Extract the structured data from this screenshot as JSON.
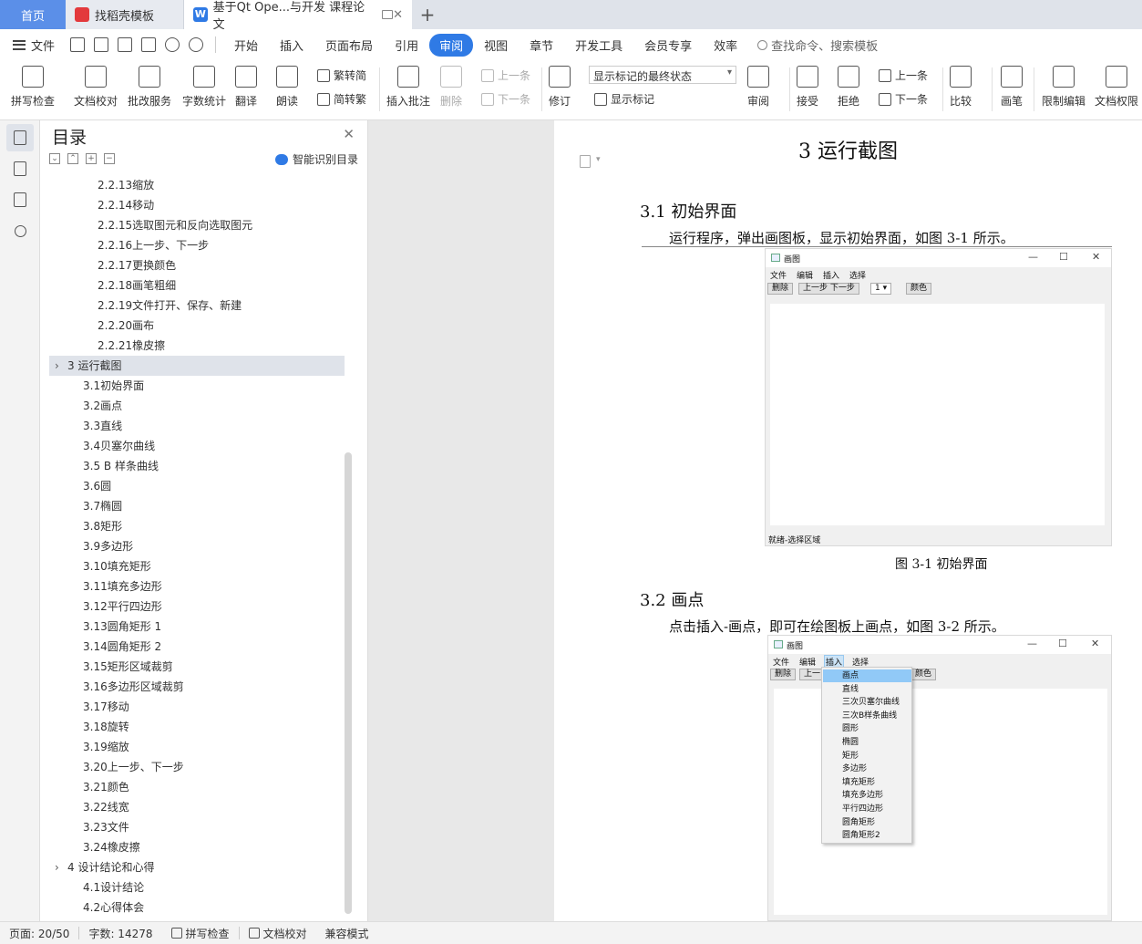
{
  "tabs": {
    "home": "首页",
    "template": "找稻壳模板",
    "document": "基于Qt Ope...与开发 课程论文"
  },
  "menu": {
    "file": "文件",
    "items": [
      "开始",
      "插入",
      "页面布局",
      "引用",
      "审阅",
      "视图",
      "章节",
      "开发工具",
      "会员专享",
      "效率"
    ],
    "active": "审阅",
    "search": "查找命令、搜索模板"
  },
  "ribbon": {
    "spellcheck": "拼写检查",
    "doc_proof": "文档校对",
    "revision_service": "批改服务",
    "word_count": "字数统计",
    "translate": "翻译",
    "read_aloud": "朗读",
    "to_traditional": "繁转简",
    "to_simplified": "简转繁",
    "insert_comment": "插入批注",
    "delete": "删除",
    "prev_comment": "上一条",
    "next_comment": "下一条",
    "track": "修订",
    "markup_dropdown": "显示标记的最终状态",
    "show_markup": "显示标记",
    "review": "审阅",
    "accept": "接受",
    "reject": "拒绝",
    "prev_change": "上一条",
    "next_change": "下一条",
    "compare": "比较",
    "pen": "画笔",
    "restrict_edit": "限制编辑",
    "doc_permission": "文档权限"
  },
  "toc": {
    "title": "目录",
    "smart": "智能识别目录",
    "items": [
      "2.2.13缩放",
      "2.2.14移动",
      "2.2.15选取图元和反向选取图元",
      "2.2.16上一步、下一步",
      "2.2.17更换颜色",
      "2.2.18画笔粗细",
      "2.2.19文件打开、保存、新建",
      "2.2.20画布",
      "2.2.21橡皮擦",
      "3 运行截图",
      "3.1初始界面",
      "3.2画点",
      "3.3直线",
      "3.4贝塞尔曲线",
      "3.5  B 样条曲线",
      "3.6圆",
      "3.7椭圆",
      "3.8矩形",
      "3.9多边形",
      "3.10填充矩形",
      "3.11填充多边形",
      "3.12平行四边形",
      "3.13圆角矩形 1",
      "3.14圆角矩形 2",
      "3.15矩形区域裁剪",
      "3.16多边形区域裁剪",
      "3.17移动",
      "3.18旋转",
      "3.19缩放",
      "3.20上一步、下一步",
      "3.21颜色",
      "3.22线宽",
      "3.23文件",
      "3.24橡皮擦",
      "4 设计结论和心得",
      "4.1设计结论",
      "4.2心得体会"
    ]
  },
  "doc": {
    "chapter_title": "3 运行截图",
    "s31_heading": "3.1  初始界面",
    "s31_text": "运行程序，弹出画图板，显示初始界面，如图 3-1 所示。",
    "fig1_caption": "图 3-1  初始界面",
    "s32_heading": "3.2  画点",
    "s32_text": "点击插入-画点，即可在绘图板上画点，如图 3-2 所示。",
    "app": {
      "title": "画图",
      "menu": [
        "文件",
        "编辑",
        "插入",
        "选择"
      ],
      "btn_delete": "删除",
      "btn_undo_redo": "上一步 下一步",
      "btn_undo_clip": "上一",
      "width_value": "1",
      "btn_color": "颜色",
      "status": "就绪-选择区域",
      "insert_menu": [
        "画点",
        "直线",
        "三次贝塞尔曲线",
        "三次B样条曲线",
        "圆形",
        "椭圆",
        "矩形",
        "多边形",
        "填充矩形",
        "填充多边形",
        "平行四边形",
        "圆角矩形",
        "圆角矩形2"
      ]
    }
  },
  "statusbar": {
    "page": "页面: 20/50",
    "words": "字数: 14278",
    "spellcheck": "拼写检查",
    "proof": "文档校对",
    "compat": "兼容模式"
  }
}
